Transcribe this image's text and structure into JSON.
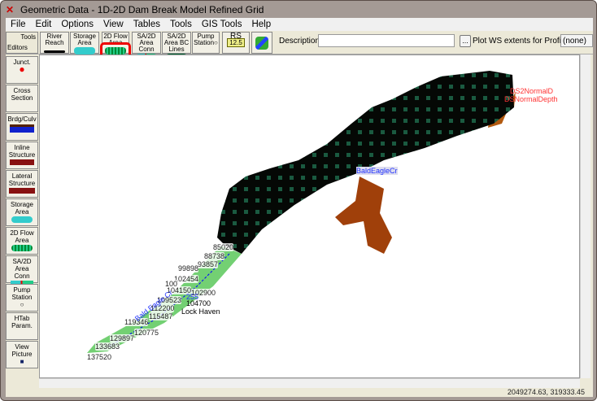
{
  "window": {
    "title": "Geometric Data - 1D-2D Dam Break Model Refined Grid"
  },
  "menu": [
    "File",
    "Edit",
    "Options",
    "View",
    "Tables",
    "Tools",
    "GIS Tools",
    "Help"
  ],
  "toolbar": {
    "tools_label": "Tools",
    "editors_label": "Editors",
    "buttons": [
      "River Reach",
      "Storage Area",
      "2D Flow Area",
      "SA/2D Area Conn",
      "SA/2D Area BC Lines",
      "Pump Station",
      "RS"
    ],
    "rs_value": "12.5",
    "description_label": "Description :",
    "description_value": "",
    "more_button": "...",
    "plot_ws_label": "Plot WS extents for Profile:",
    "profile_value": "(none)"
  },
  "palette": [
    "Junct.",
    "Cross Section",
    "Brdg/Culv",
    "Inline Structure",
    "Lateral Structure",
    "Storage Area",
    "2D Flow Area",
    "SA/2D Area Conn",
    "Pump Station",
    "HTab Param.",
    "View Picture"
  ],
  "map": {
    "cross_sections": [
      "85020",
      "88738",
      "93857",
      "99898",
      "102454",
      "100",
      "104150",
      "102900",
      "109523",
      "104700",
      "112200",
      "115487",
      "119346",
      "120775",
      "129897",
      "133683",
      "137520"
    ],
    "river_label": "Bald Eagle Cr",
    "reach_id": "255",
    "town": "Lock Haven",
    "area_label": "BaldEagleCr",
    "bc1": "DS2NormalD",
    "bc2": "DSNormalDepth"
  },
  "status": {
    "coords": "2049274.63, 319333.45"
  }
}
